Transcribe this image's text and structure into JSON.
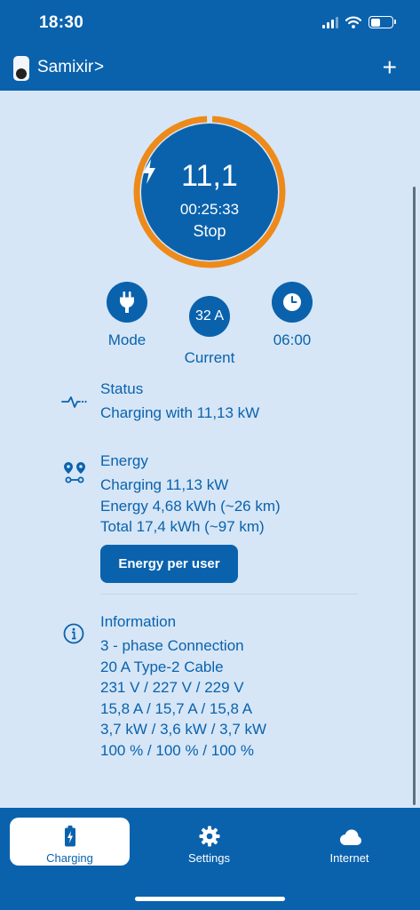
{
  "status_bar": {
    "time": "18:30"
  },
  "header": {
    "device_name": "Samixir",
    "chevron": ">",
    "add_label": "+"
  },
  "charger": {
    "power": "11,1",
    "session_time": "00:25:33",
    "action_label": "Stop",
    "ring_color": "#ee8a1a"
  },
  "controls": {
    "mode_label": "Mode",
    "current_value": "32 A",
    "current_label": "Current",
    "timer_label": "06:00"
  },
  "status": {
    "title": "Status",
    "text": "Charging with 11,13 kW"
  },
  "energy": {
    "title": "Energy",
    "lines": [
      "Charging 11,13 kW",
      "Energy 4,68 kWh (~26 km)",
      "Total 17,4 kWh (~97 km)"
    ],
    "button_label": "Energy per user"
  },
  "information": {
    "title": "Information",
    "lines": [
      "3 - phase Connection",
      "20 A Type-2 Cable",
      "231 V / 227 V / 229 V",
      "15,8 A / 15,7 A / 15,8 A",
      "3,7 kW / 3,6 kW / 3,7 kW",
      "100 % / 100 % / 100 %"
    ]
  },
  "tabs": [
    {
      "label": "Charging",
      "icon": "battery-charging-icon",
      "active": true
    },
    {
      "label": "Settings",
      "icon": "gear-icon",
      "active": false
    },
    {
      "label": "Internet",
      "icon": "cloud-icon",
      "active": false
    }
  ],
  "colors": {
    "primary": "#0a62ad",
    "background": "#d6e6f6",
    "accent": "#ee8a1a"
  }
}
